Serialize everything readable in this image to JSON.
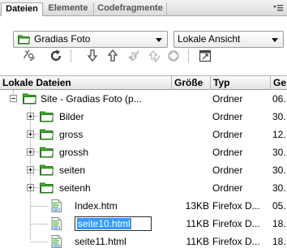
{
  "tabs": [
    {
      "label": "Dateien"
    },
    {
      "label": "Elemente"
    },
    {
      "label": "Codefragmente"
    }
  ],
  "site_select": {
    "value": "Gradias Foto"
  },
  "view_select": {
    "value": "Lokale Ansicht"
  },
  "toolbar_icons": [
    "connect-icon",
    "refresh-icon",
    "get-files-icon",
    "put-files-icon",
    "check-out-icon",
    "check-in-icon",
    "sync-icon",
    "expand-panel-icon"
  ],
  "columns": {
    "name": "Lokale Dateien",
    "size": "Größe",
    "type": "Typ",
    "date": "Ge"
  },
  "rows": [
    {
      "name": "Site - Gradias Foto (p...",
      "size": "",
      "type": "Ordner",
      "date": "06."
    },
    {
      "name": "Bilder",
      "size": "",
      "type": "Ordner",
      "date": "30."
    },
    {
      "name": "gross",
      "size": "",
      "type": "Ordner",
      "date": "12."
    },
    {
      "name": "grossh",
      "size": "",
      "type": "Ordner",
      "date": "30."
    },
    {
      "name": "seiten",
      "size": "",
      "type": "Ordner",
      "date": "30."
    },
    {
      "name": "seitenh",
      "size": "",
      "type": "Ordner",
      "date": "30."
    },
    {
      "name": "Index.htm",
      "size": "13KB",
      "type": "Firefox D...",
      "date": "05."
    },
    {
      "name": "seite10.html",
      "size": "11KB",
      "type": "Firefox D...",
      "date": "18."
    },
    {
      "name": "seite11.html",
      "size": "11KB",
      "type": "Firefox D...",
      "date": "18."
    }
  ],
  "colors": {
    "folder": "#3fae2a",
    "selection": "#3399ff"
  }
}
